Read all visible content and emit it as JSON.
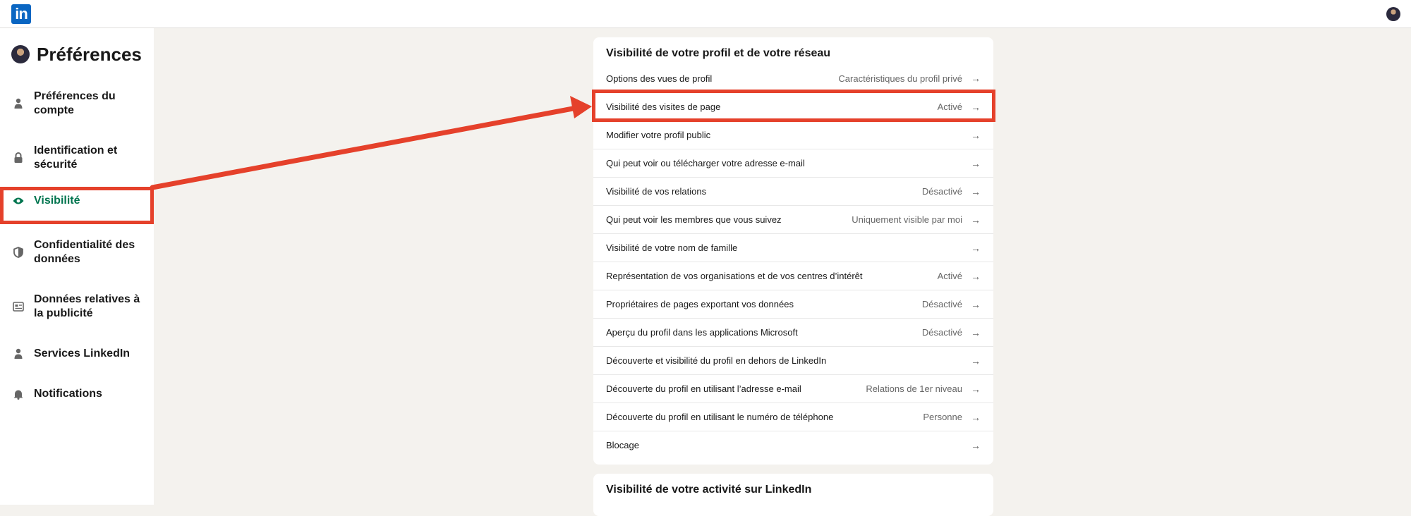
{
  "header": {
    "logo_text": "in"
  },
  "sidebar": {
    "title": "Préférences",
    "items": [
      {
        "label": "Préférences du compte",
        "icon": "person-icon"
      },
      {
        "label": "Identification et sécurité",
        "icon": "lock-icon"
      },
      {
        "label": "Visibilité",
        "icon": "eye-icon",
        "active": true
      },
      {
        "label": "Confidentialité des données",
        "icon": "shield-icon"
      },
      {
        "label": "Données relatives à la publicité",
        "icon": "ad-card-icon"
      },
      {
        "label": "Services LinkedIn",
        "icon": "person-icon"
      },
      {
        "label": "Notifications",
        "icon": "bell-icon"
      }
    ]
  },
  "card1": {
    "title": "Visibilité de votre profil et de votre réseau",
    "rows": [
      {
        "label": "Options des vues de profil",
        "value": "Caractéristiques du profil privé"
      },
      {
        "label": "Visibilité des visites de page",
        "value": "Activé"
      },
      {
        "label": "Modifier votre profil public",
        "value": ""
      },
      {
        "label": "Qui peut voir ou télécharger votre adresse e-mail",
        "value": ""
      },
      {
        "label": "Visibilité de vos relations",
        "value": "Désactivé"
      },
      {
        "label": "Qui peut voir les membres que vous suivez",
        "value": "Uniquement visible par moi"
      },
      {
        "label": "Visibilité de votre nom de famille",
        "value": ""
      },
      {
        "label": "Représentation de vos organisations et de vos centres d’intérêt",
        "value": "Activé"
      },
      {
        "label": "Propriétaires de pages exportant vos données",
        "value": "Désactivé"
      },
      {
        "label": "Aperçu du profil dans les applications Microsoft",
        "value": "Désactivé"
      },
      {
        "label": "Découverte et visibilité du profil en dehors de LinkedIn",
        "value": ""
      },
      {
        "label": "Découverte du profil en utilisant l’adresse e-mail",
        "value": "Relations de 1er niveau"
      },
      {
        "label": "Découverte du profil en utilisant le numéro de téléphone",
        "value": "Personne"
      },
      {
        "label": "Blocage",
        "value": ""
      }
    ]
  },
  "card2": {
    "title": "Visibilité de votre activité sur LinkedIn"
  },
  "colors": {
    "accent_green": "#01754f",
    "annotation_red": "#e5412b",
    "linkedin_blue": "#0a66c2"
  }
}
